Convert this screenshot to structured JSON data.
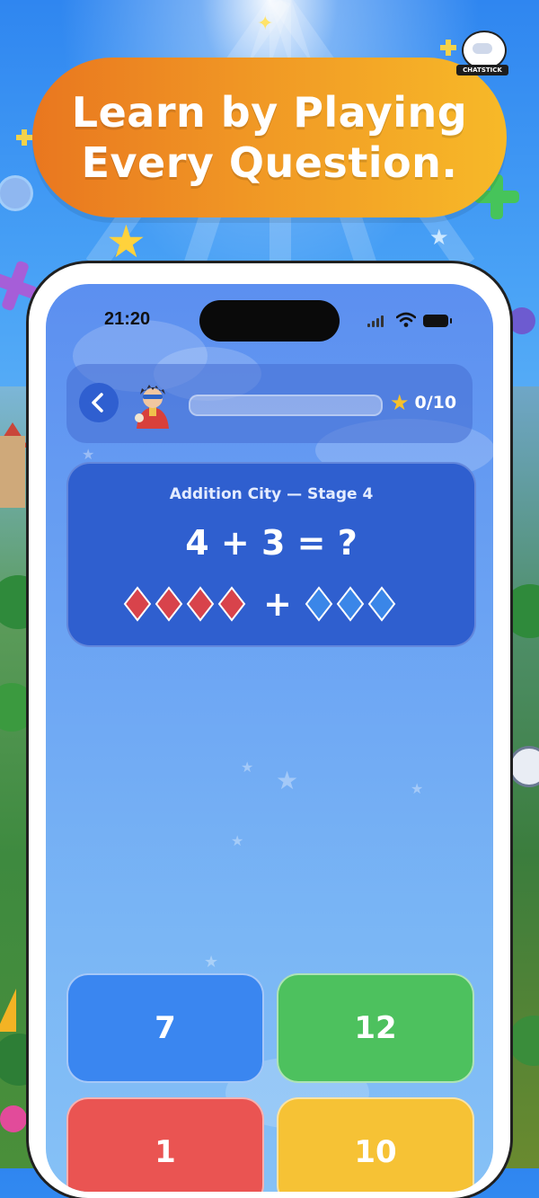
{
  "banner": {
    "line1": "Learn by Playing",
    "line2": "Every Question."
  },
  "brand": {
    "name": "CHATSTICK"
  },
  "status": {
    "time": "21:20"
  },
  "header": {
    "score": "0/10",
    "progress_fraction": 0
  },
  "question": {
    "stage_title": "Addition City — Stage 4",
    "equation": "4 + 3 = ?",
    "left_count": 4,
    "right_count": 3,
    "operator": "+"
  },
  "answers": [
    {
      "label": "7",
      "color": "#3a86f0"
    },
    {
      "label": "12",
      "color": "#4dc15e"
    },
    {
      "label": "1",
      "color": "#ea5452"
    },
    {
      "label": "10",
      "color": "#f6c235"
    }
  ],
  "icons": {
    "back": "chevron-left-icon",
    "avatar": "character-avatar-icon",
    "score": "star-icon",
    "wifi": "wifi-icon",
    "battery": "battery-icon"
  }
}
